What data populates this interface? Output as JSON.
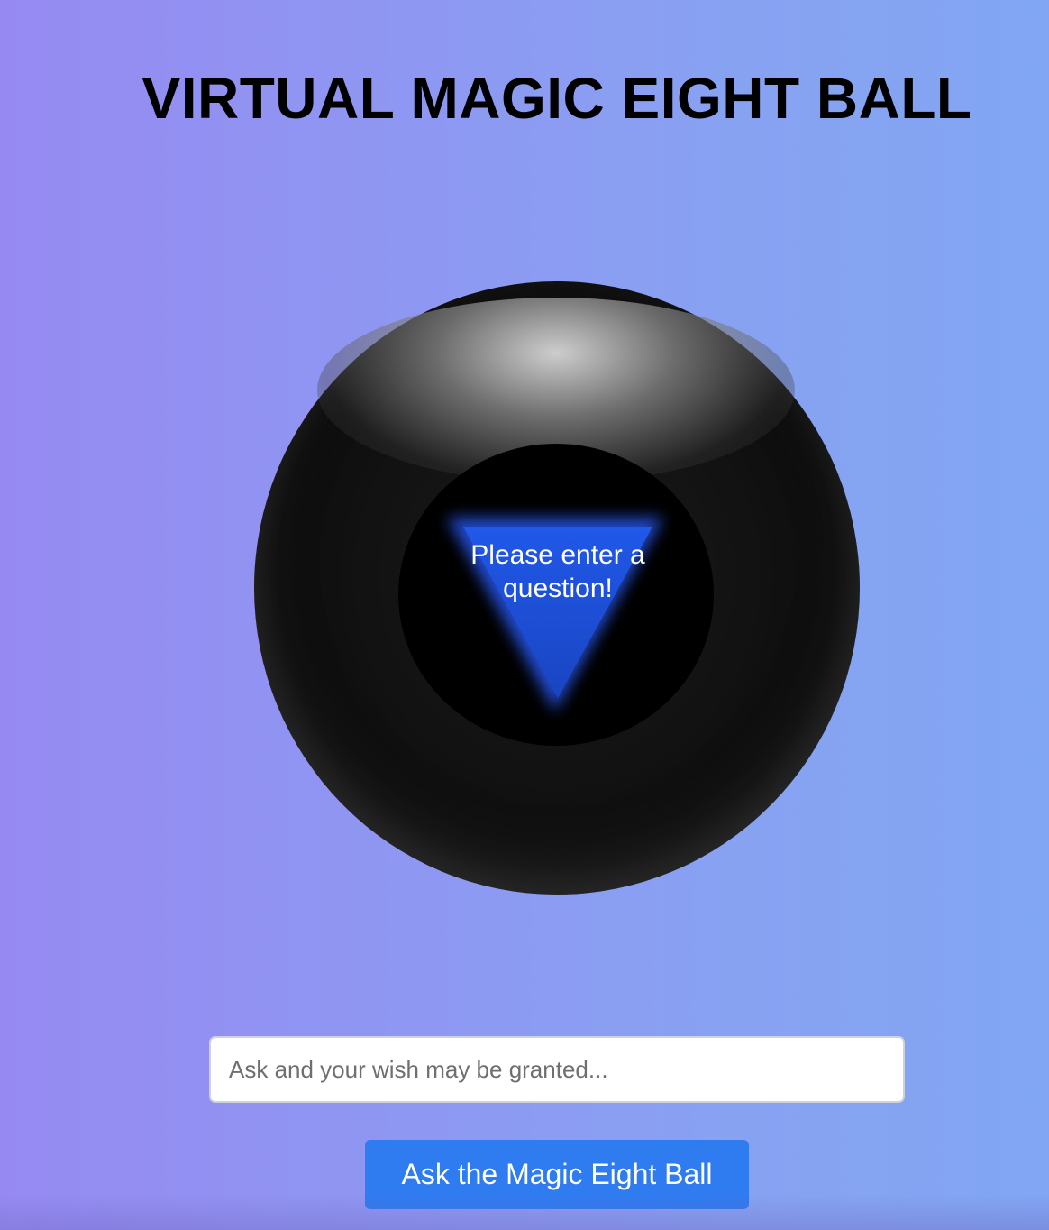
{
  "header": {
    "title": "VIRTUAL MAGIC EIGHT BALL"
  },
  "eight_ball": {
    "answer": "Please enter a question!",
    "triangle_color": "#1d4fd9",
    "body_color": "#111111"
  },
  "question_form": {
    "input_value": "",
    "input_placeholder": "Ask and your wish may be granted...",
    "submit_label": "Ask the Magic Eight Ball",
    "button_color": "#2f7bf0"
  },
  "theme": {
    "background_gradient": [
      "#968af2",
      "#81a6f3"
    ]
  }
}
